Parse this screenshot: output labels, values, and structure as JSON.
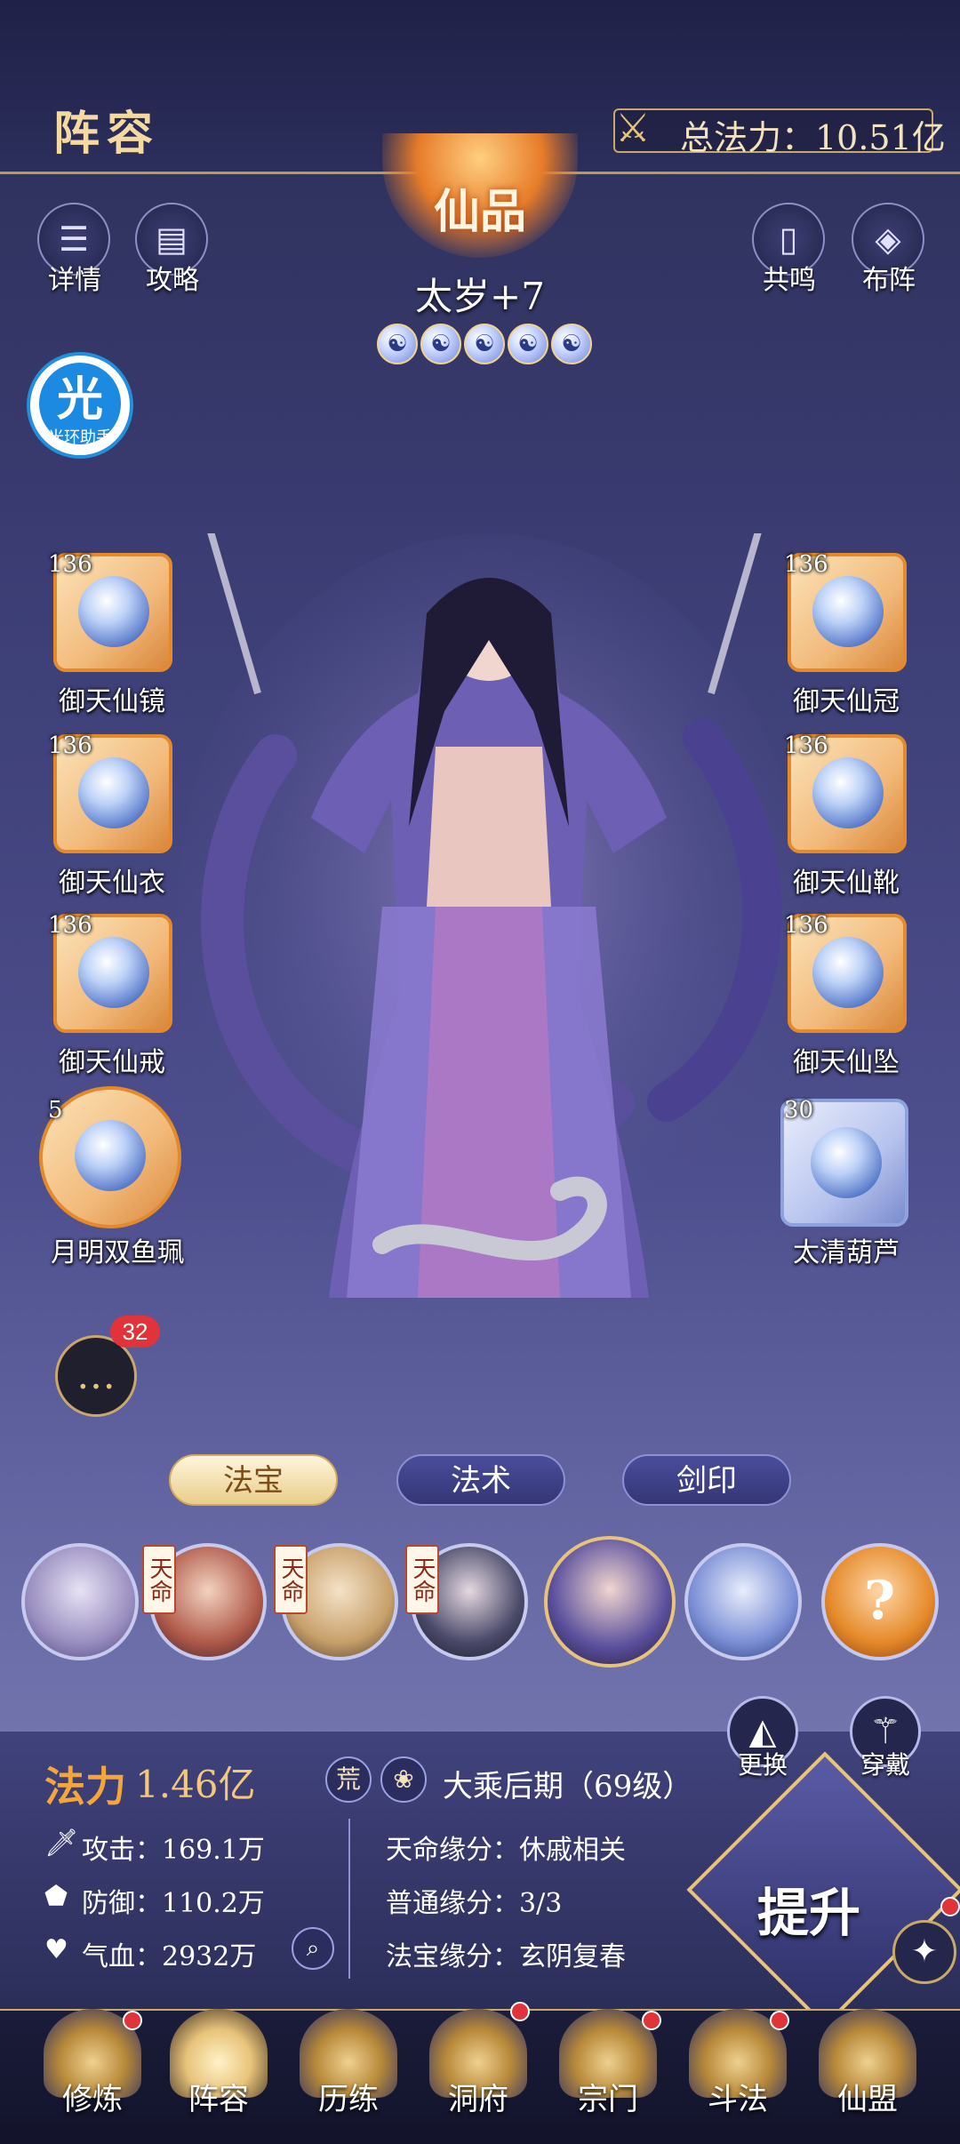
{
  "header": {
    "title": "阵容",
    "total_power_label": "总法力：10.51亿"
  },
  "top_buttons": {
    "details": "详情",
    "strategy": "攻略",
    "resonance": "共鸣",
    "formation": "布阵"
  },
  "hero": {
    "rank": "仙品",
    "name": "太岁+7",
    "stars": [
      "☯",
      "☯",
      "☯",
      "☯",
      "☯"
    ]
  },
  "helper": {
    "label": "光环助手",
    "glyph": "光"
  },
  "equipment": {
    "left": [
      {
        "level": "136",
        "label": "御天仙镜"
      },
      {
        "level": "136",
        "label": "御天仙衣"
      },
      {
        "level": "136",
        "label": "御天仙戒"
      },
      {
        "level": "5",
        "label": "月明双鱼珮"
      }
    ],
    "right": [
      {
        "level": "136",
        "label": "御天仙冠"
      },
      {
        "level": "136",
        "label": "御天仙靴"
      },
      {
        "level": "136",
        "label": "御天仙坠"
      },
      {
        "level": "30",
        "label": "太清葫芦"
      }
    ]
  },
  "chat": {
    "badge": "32"
  },
  "tabs": {
    "treasure": "法宝",
    "spell": "法术",
    "sword_seal": "剑印"
  },
  "hero_list": {
    "tianming": "天命"
  },
  "stats": {
    "power_label": "法力",
    "power_value": "1.46亿",
    "realm_badge1": "荒",
    "realm": "大乘后期（69级）",
    "attack": "攻击：169.1万",
    "defense": "防御：110.2万",
    "hp": "气血：2932万",
    "fate_bond": "天命缘分：休戚相关",
    "normal_bond": "普通缘分：3/3",
    "treasure_bond": "法宝缘分：玄阴复春"
  },
  "side_buttons": {
    "replace": "更换",
    "equip": "穿戴"
  },
  "upgrade_label": "提升",
  "nav": [
    "修炼",
    "阵容",
    "历练",
    "洞府",
    "宗门",
    "斗法",
    "仙盟"
  ],
  "colors": {
    "accent_gold": "#e8c37a",
    "badge_red": "#e0343a",
    "orange_slot": "#e58a2a"
  }
}
